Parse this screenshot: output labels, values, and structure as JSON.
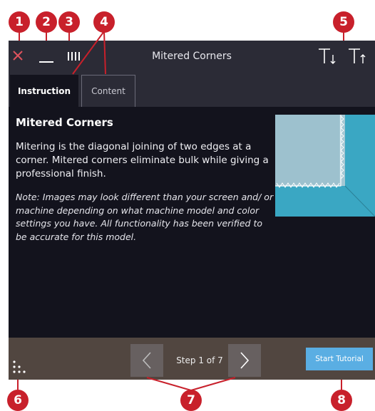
{
  "window": {
    "title": "Mitered Corners"
  },
  "toolbar": {
    "close_icon": "close-icon",
    "minimize_icon": "minimize-icon",
    "move_icon": "move-handle-icon",
    "decrease_text_icon": "text-size-decrease-icon",
    "increase_text_icon": "text-size-increase-icon"
  },
  "tabs": [
    {
      "label": "Instruction",
      "active": true
    },
    {
      "label": "Content",
      "active": false
    }
  ],
  "content": {
    "title": "Mitered Corners",
    "body": "Mitering is the diagonal joining of two edges at a corner. Mitered corners eliminate bulk while giving a professional finish.",
    "note": "Note: Images may look different than your screen and/ or machine depending on what machine model and color settings you have. All functionality has been verified to be accurate for this model."
  },
  "footer": {
    "step_label": "Step 1 of 7",
    "prev_icon": "chevron-left-icon",
    "next_icon": "chevron-right-icon",
    "start_label": "Start Tutorial",
    "menu_icon": "dots-menu-icon"
  },
  "callouts": [
    "1",
    "2",
    "3",
    "4",
    "5",
    "6",
    "7",
    "8"
  ],
  "colors": {
    "callout": "#c8202b",
    "background": "#13131d",
    "topbar": "#2b2b36",
    "bottombar": "#514640",
    "accent": "#5aaee3",
    "close": "#e0535d",
    "fabric_light": "#a6c8d4",
    "fabric_dark": "#3aa7c3"
  }
}
